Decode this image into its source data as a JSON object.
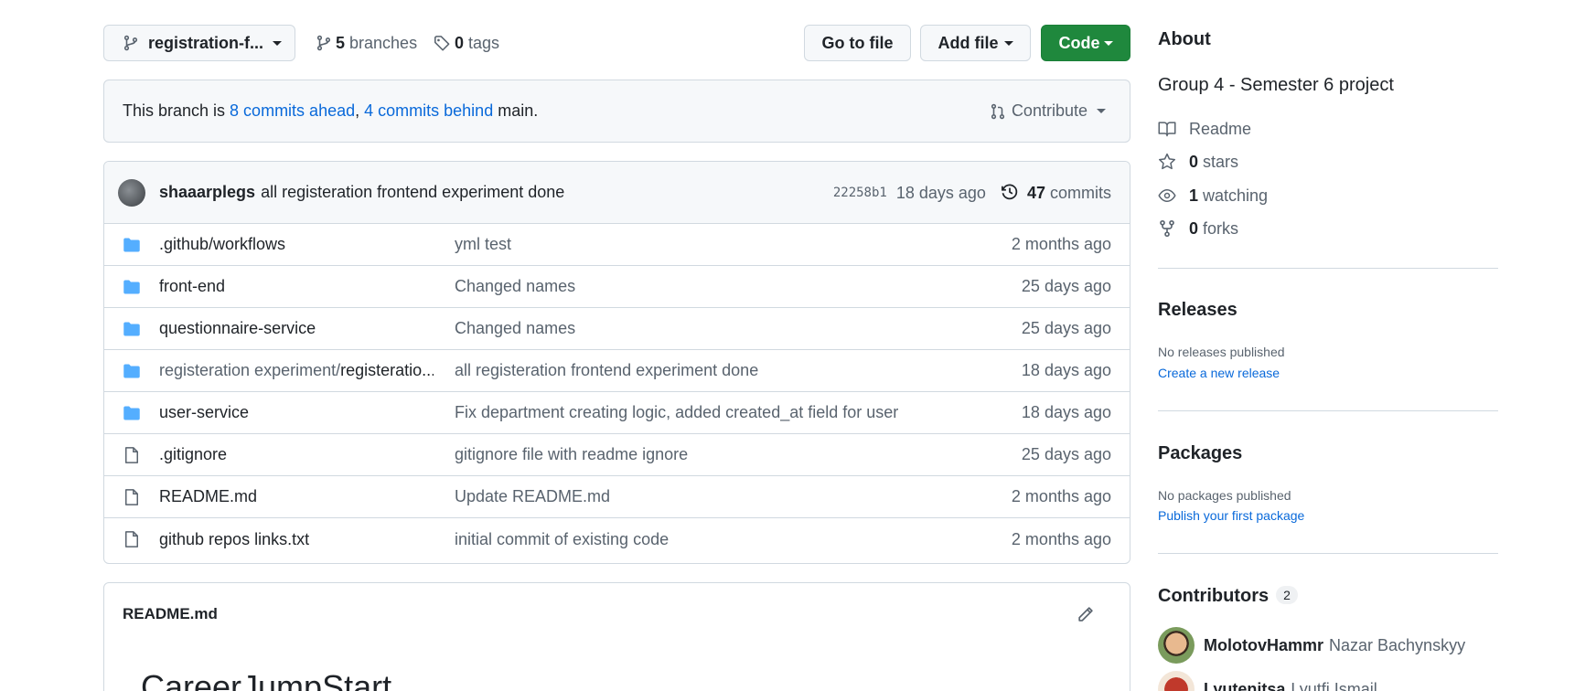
{
  "toolbar": {
    "branch_name": "registration-f...",
    "branches_count": "5",
    "branches_label": "branches",
    "tags_count": "0",
    "tags_label": "tags",
    "go_to_file": "Go to file",
    "add_file": "Add file",
    "code": "Code"
  },
  "banner": {
    "prefix": "This branch is ",
    "ahead": "8 commits ahead",
    "sep": ", ",
    "behind": "4 commits behind",
    "suffix": " main.",
    "contribute": "Contribute"
  },
  "latest_commit": {
    "author": "shaaarplegs",
    "message": "all registeration frontend experiment done",
    "sha": "22258b1",
    "ago": "18 days ago",
    "commit_count": "47",
    "commits_label": "commits"
  },
  "files": [
    {
      "type": "dir",
      "name": ".github/workflows",
      "message": "yml test",
      "age": "2 months ago"
    },
    {
      "type": "dir",
      "name": "front-end",
      "message": "Changed names",
      "age": "25 days ago"
    },
    {
      "type": "dir",
      "name": "questionnaire-service",
      "message": "Changed names",
      "age": "25 days ago"
    },
    {
      "type": "dir",
      "name_prefix": "registeration experiment/",
      "name": "registeratio...",
      "message": "all registeration frontend experiment done",
      "age": "18 days ago"
    },
    {
      "type": "dir",
      "name": "user-service",
      "message": "Fix department creating logic, added created_at field for user",
      "age": "18 days ago"
    },
    {
      "type": "file",
      "name": ".gitignore",
      "message": "gitignore file with readme ignore",
      "age": "25 days ago"
    },
    {
      "type": "file",
      "name": "README.md",
      "message": "Update README.md",
      "age": "2 months ago"
    },
    {
      "type": "file",
      "name": "github repos links.txt",
      "message": "initial commit of existing code",
      "age": "2 months ago"
    }
  ],
  "readme": {
    "filename": "README.md",
    "heading": "CareerJumpStart"
  },
  "sidebar": {
    "about_title": "About",
    "description": "Group 4 - Semester 6 project",
    "readme_label": "Readme",
    "stars_count": "0",
    "stars_label": "stars",
    "watching_count": "1",
    "watching_label": "watching",
    "forks_count": "0",
    "forks_label": "forks",
    "releases_title": "Releases",
    "releases_empty": "No releases published",
    "releases_link": "Create a new release",
    "packages_title": "Packages",
    "packages_empty": "No packages published",
    "packages_link": "Publish your first package",
    "contributors_title": "Contributors",
    "contributors_count": "2",
    "contributors": [
      {
        "login": "MolotovHammr",
        "name": "Nazar Bachynskyy"
      },
      {
        "login": "Lyutenitsa",
        "name": "Lyutfi Ismail"
      }
    ]
  },
  "colors": {
    "accent_link": "#0969da",
    "primary_button": "#1f883d",
    "folder_icon": "#54aeff"
  }
}
